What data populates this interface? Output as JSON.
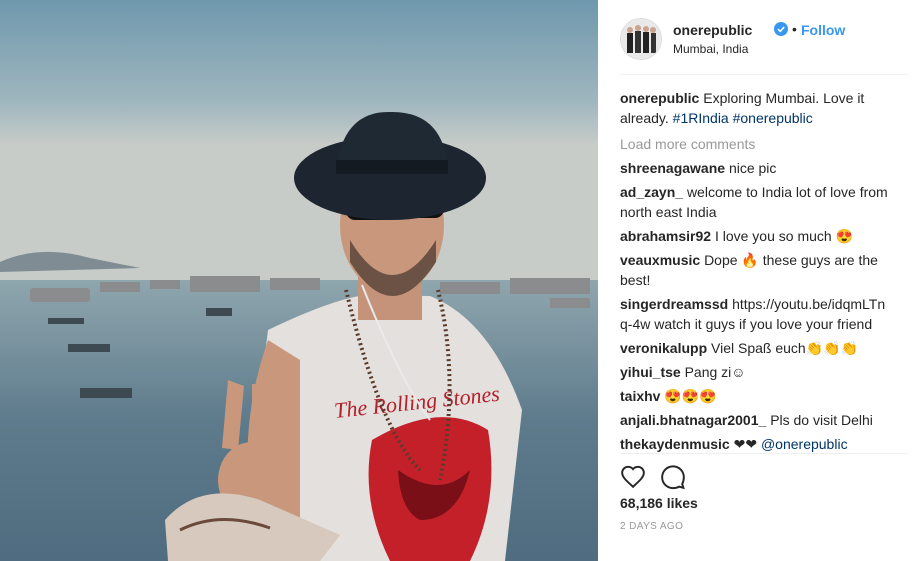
{
  "post": {
    "username": "onerepublic",
    "separator": "•",
    "follow_label": "Follow",
    "location": "Mumbai, India",
    "caption_user": "onerepublic",
    "caption_text": "Exploring Mumbai. Love it already.",
    "caption_tags": "#1RIndia #onerepublic",
    "shirt_text": "The Rolling Stones",
    "load_more": "Load more comments",
    "likes": "68,186 likes",
    "time": "2 DAYS AGO"
  },
  "comments": [
    {
      "user": "shreenagawane",
      "text": "nice pic"
    },
    {
      "user": "ad_zayn_",
      "text": "welcome to India lot of love from north east India"
    },
    {
      "user": "abrahamsir92",
      "text": "I love you so much 😍"
    },
    {
      "user": "veauxmusic",
      "text": "Dope 🔥 these guys are the best!"
    },
    {
      "user": "singerdreamssd",
      "text": "https://youtu.be/idqmLTnq-4w watch it guys if you love your friend"
    },
    {
      "user": "veronikalupp",
      "text": "Viel Spaß euch👏👏👏"
    },
    {
      "user": "yihui_tse",
      "text": "Pang zi☺"
    },
    {
      "user": "taixhv",
      "text": "😍😍😍"
    },
    {
      "user": "anjali.bhatnagar2001_",
      "text": "Pls do visit Delhi"
    },
    {
      "user": "thekaydenmusic",
      "text": "❤❤ ",
      "mention": "@onerepublic"
    }
  ],
  "icons": {
    "verified": "verified-badge-icon",
    "like": "heart-icon",
    "comment": "comment-bubble-icon"
  },
  "colors": {
    "link": "#003569",
    "follow": "#3897f0",
    "verified": "#3897f0",
    "muted": "#999999"
  }
}
